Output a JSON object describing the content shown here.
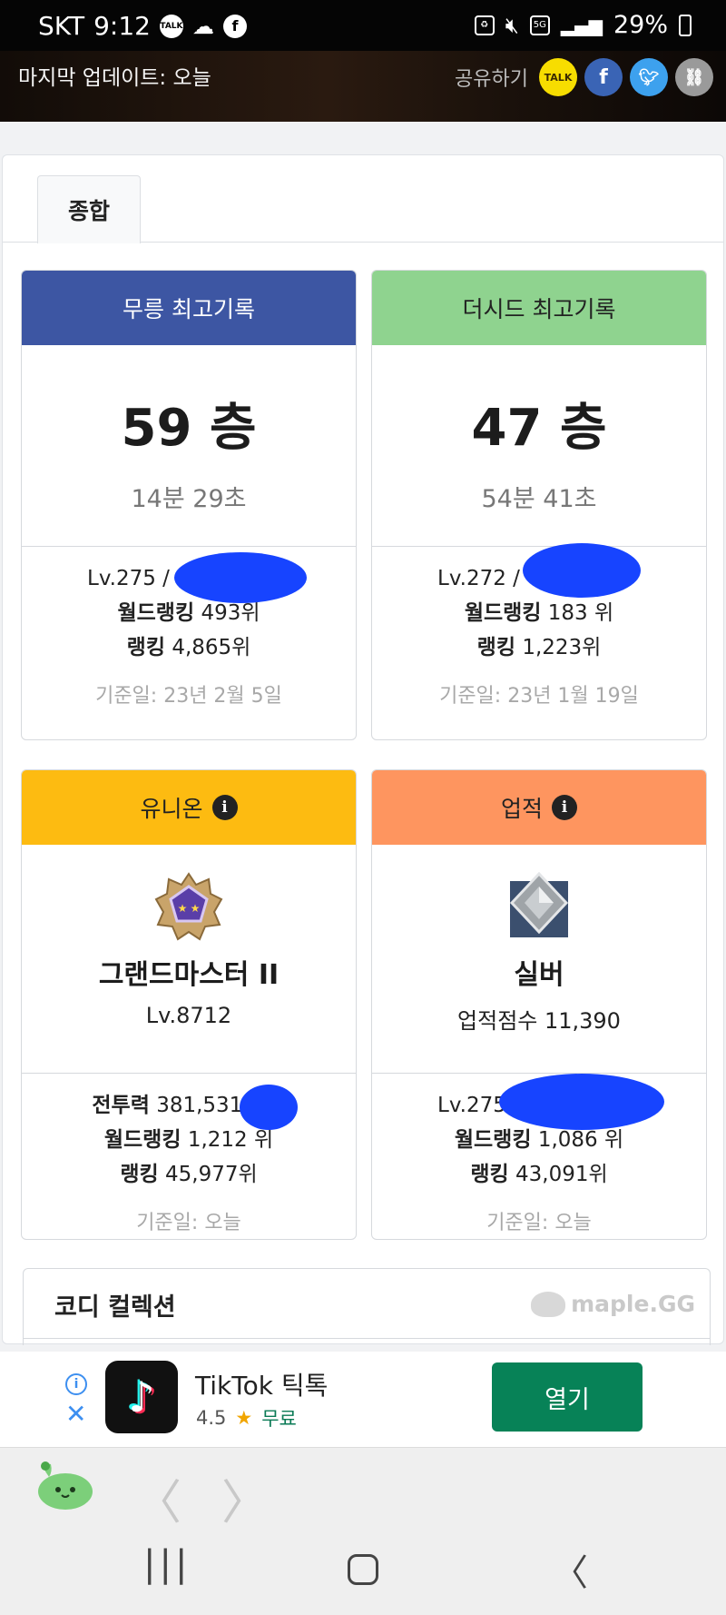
{
  "status_bar": {
    "carrier": "SKT",
    "time": "9:12",
    "battery": "29%"
  },
  "header": {
    "last_update": "마지막 업데이트: 오늘",
    "share_label": "공유하기",
    "share_buttons": [
      "kakaotalk-icon",
      "facebook-icon",
      "twitter-icon",
      "link-icon"
    ],
    "kakao_text": "TALK"
  },
  "tabs": [
    {
      "label": "종합",
      "active": true
    }
  ],
  "cards": {
    "mureung": {
      "title": "무릉 최고기록",
      "color": "#3d56a3",
      "floor": "59 층",
      "time": "14분 29초",
      "level": "Lv.275 /",
      "world_rank_label": "월드랭킹",
      "world_rank": "493위",
      "rank_label": "랭킹",
      "rank": "4,865위",
      "date": "기준일: 23년 2월 5일"
    },
    "theseed": {
      "title": "더시드 최고기록",
      "color": "#8fd38f",
      "floor": "47 층",
      "time": "54분 41초",
      "level": "Lv.272 /",
      "world_rank_label": "월드랭킹",
      "world_rank": "183 위",
      "rank_label": "랭킹",
      "rank": "1,223위",
      "date": "기준일: 23년 1월 19일"
    },
    "union": {
      "title": "유니온",
      "color": "#fdbb11",
      "tier": "그랜드마스터 II",
      "level": "Lv.8712",
      "power_label": "전투력",
      "power": "381,531,",
      "world_rank_label": "월드랭킹",
      "world_rank": "1,212 위",
      "rank_label": "랭킹",
      "rank": "45,977위",
      "date": "기준일: 오늘"
    },
    "achievement": {
      "title": "업적",
      "color": "#fe955f",
      "tier": "실버",
      "score": "업적점수 11,390",
      "level": "Lv.275",
      "world_rank_label": "월드랭킹",
      "world_rank": "1,086 위",
      "rank_label": "랭킹",
      "rank": "43,091위",
      "date": "기준일: 오늘"
    }
  },
  "codi": {
    "title": "코디 컬렉션",
    "watermark": "maple.GG"
  },
  "ad": {
    "app_name": "TikTok 틱톡",
    "rating": "4.5",
    "price": "무료",
    "button": "열기"
  }
}
